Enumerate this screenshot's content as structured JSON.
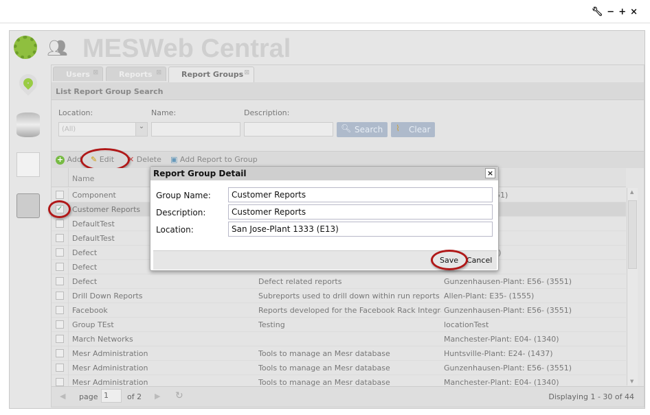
{
  "app": {
    "title": "MESWeb Central",
    "window_controls": [
      "wrench-icon",
      "minimize-icon",
      "maximize-icon",
      "close-icon"
    ]
  },
  "tabs": [
    {
      "label": "Users",
      "active": false
    },
    {
      "label": "Reports",
      "active": false
    },
    {
      "label": "Report Groups",
      "active": true
    }
  ],
  "search": {
    "title": "List Report Group Search",
    "location_label": "Location:",
    "location_value": "(All)",
    "name_label": "Name:",
    "name_value": "",
    "description_label": "Description:",
    "description_value": "",
    "search_button": "Search",
    "clear_button": "Clear"
  },
  "toolbar": {
    "add": "Add",
    "edit": "Edit",
    "delete": "Delete",
    "add_report": "Add Report to Group"
  },
  "grid": {
    "columns": [
      "Name"
    ],
    "rows": [
      {
        "name": "Component",
        "description": "",
        "location": "lant: E56- (3551)",
        "checked": false
      },
      {
        "name": "Customer Reports",
        "description": "",
        "location": "333 (E13)",
        "checked": true
      },
      {
        "name": "DefaultTest",
        "description": "",
        "location": "",
        "checked": false
      },
      {
        "name": "DefaultTest",
        "description": "",
        "location": "",
        "checked": false
      },
      {
        "name": "Defect",
        "description": "",
        "location": "nt: E04- (1340)",
        "checked": false
      },
      {
        "name": "Defect",
        "description": "",
        "location": "(1555)",
        "checked": false
      },
      {
        "name": "Defect",
        "description": "Defect related reports",
        "location": "Gunzenhausen-Plant: E56- (3551)",
        "checked": false
      },
      {
        "name": "Drill Down Reports",
        "description": "Subreports used to drill down within run reports",
        "location": "Allen-Plant: E35- (1555)",
        "checked": false
      },
      {
        "name": "Facebook",
        "description": "Reports developed for the Facebook Rack Integra...",
        "location": "Gunzenhausen-Plant: E56- (3551)",
        "checked": false
      },
      {
        "name": "Group TEst",
        "description": "Testing",
        "location": "locationTest",
        "checked": false
      },
      {
        "name": "March Networks",
        "description": "",
        "location": "Manchester-Plant: E04- (1340)",
        "checked": false
      },
      {
        "name": "Mesr Administration",
        "description": "Tools to manage an Mesr database",
        "location": "Huntsville-Plant: E24- (1437)",
        "checked": false
      },
      {
        "name": "Mesr Administration",
        "description": "Tools to manage an Mesr database",
        "location": "Gunzenhausen-Plant: E56- (3551)",
        "checked": false
      },
      {
        "name": "Mesr Administration",
        "description": "Tools to manage an Mesr database",
        "location": "Manchester-Plant: E04- (1340)",
        "checked": false
      }
    ]
  },
  "pager": {
    "page_label": "page",
    "page_value": "1",
    "of_label": "of 2",
    "display": "Displaying 1 - 30 of 44"
  },
  "dialog": {
    "title": "Report Group Detail",
    "group_name_label": "Group Name:",
    "group_name_value": "Customer Reports",
    "description_label": "Description:",
    "description_value": "Customer Reports",
    "location_label": "Location:",
    "location_value": "San Jose-Plant 1333 (E13)",
    "save": "Save",
    "cancel": "Cancel"
  },
  "colors": {
    "highlight_ring": "#b01818",
    "button_bg": "#aebacb"
  }
}
